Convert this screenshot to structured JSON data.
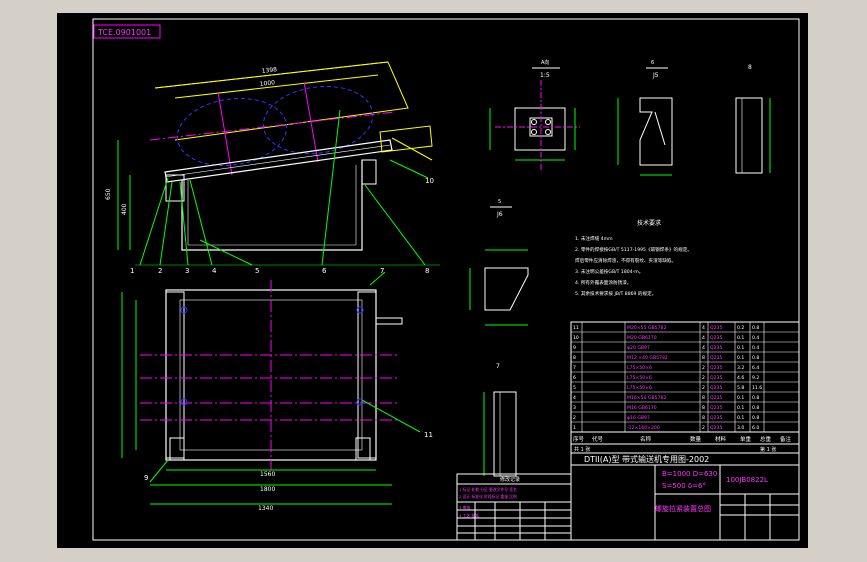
{
  "drawing": {
    "code_tag": "TCE.0901001",
    "title_line": "DTII(A)型 带式输送机专用图-2002",
    "params_1": "B=1000 D=630",
    "params_2": "S=500 δ=6°",
    "drawing_no": "100JB0822L",
    "drawing_name": "螺旋拉紧装置总图",
    "column_headers": [
      "序号",
      "代号",
      "名称",
      "数量",
      "材料",
      "单重",
      "总重",
      "备注"
    ],
    "parts_rows": [
      {
        "no": "11",
        "spec": "M20×55 GB5782",
        "qty": "4",
        "mat": "Q235",
        "w1": "0.2",
        "w2": "0.8"
      },
      {
        "no": "10",
        "spec": "M20 GB6170",
        "qty": "4",
        "mat": "Q235",
        "w1": "0.1",
        "w2": "0.4"
      },
      {
        "no": "9",
        "spec": "φ20 GB97",
        "qty": "4",
        "mat": "Q235",
        "w1": "0.1",
        "w2": "0.4"
      },
      {
        "no": "8",
        "spec": "M12 ×40 GB5782",
        "qty": "8",
        "mat": "Q235",
        "w1": "0.1",
        "w2": "0.8"
      },
      {
        "no": "7",
        "spec": "L75×50×6",
        "qty": "2",
        "mat": "Q235",
        "w1": "3.2",
        "w2": "6.4"
      },
      {
        "no": "6",
        "spec": "L75×50×6",
        "qty": "2",
        "mat": "Q235",
        "w1": "4.6",
        "w2": "9.2"
      },
      {
        "no": "5",
        "spec": "L75×50×6",
        "qty": "2",
        "mat": "Q235",
        "w1": "5.8",
        "w2": "11.6"
      },
      {
        "no": "4",
        "spec": "M16×50 GB5782",
        "qty": "8",
        "mat": "Q235",
        "w1": "0.1",
        "w2": "0.8"
      },
      {
        "no": "3",
        "spec": "M16 GB6170",
        "qty": "8",
        "mat": "Q235",
        "w1": "0.1",
        "w2": "0.8"
      },
      {
        "no": "2",
        "spec": "φ16 GB97",
        "qty": "8",
        "mat": "Q235",
        "w1": "0.1",
        "w2": "0.8"
      },
      {
        "no": "1",
        "spec": "-12×160×200",
        "qty": "2",
        "mat": "Q235",
        "w1": "3.0",
        "w2": "6.0"
      }
    ],
    "notes_title": "技术要求",
    "notes": [
      "1. 未注焊缝 4mm",
      "2. 零件的焊接按GB/T 5117-1995《碳钢焊条》的规定。",
      "   焊后零件应清除焊渣，不得有裂纹、夹渣等缺陷。",
      "3. 未注明公差按GB/T 1804-m。",
      "4. 所有外露表面涂防锈漆。",
      "5. 其余技术要求按 JB/T 8869 的规定。"
    ],
    "view_labels": {
      "a": "1:5",
      "b": "J5",
      "c": "J6",
      "d": "7"
    },
    "leaders": [
      "1",
      "2",
      "3",
      "4",
      "5",
      "6",
      "7",
      "8",
      "9",
      "10",
      "11"
    ],
    "dims": {
      "top_len": "1398",
      "mid_len": "1000",
      "plan_w1": "1560",
      "plan_w2": "1800",
      "h1": "400",
      "h2": "650",
      "bottom": "1340"
    },
    "rev_table_title": "修改记录",
    "rev_rows": [
      "1  标记  处数  分区  更改文件号  签名",
      "2  设计  标准化  阶段标记  重量  比例",
      "3  审核",
      "4  工艺  批准"
    ],
    "sheet_info": [
      "共 1 张",
      "第 1 张"
    ]
  },
  "colors": {
    "sheet": "#000000",
    "line": "#ffffff",
    "yellow": "#ffff00",
    "green": "#00ff00",
    "magenta": "#ff00ff",
    "cyan": "#00ffff",
    "blue": "#3333ff",
    "window": "#d4d0c8"
  }
}
